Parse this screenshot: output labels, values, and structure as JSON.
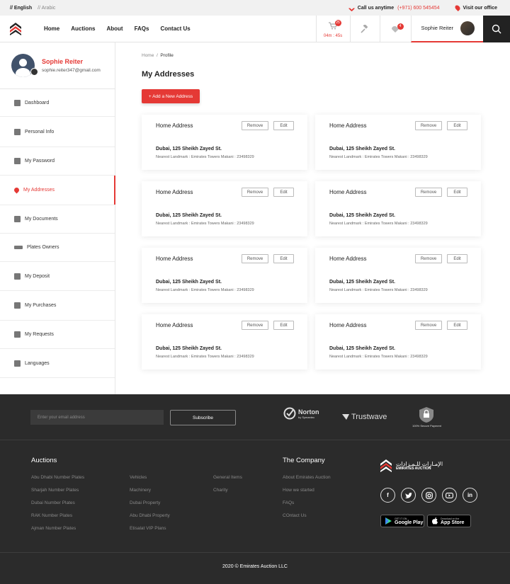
{
  "topbar": {
    "lang_en": "// English",
    "lang_ar": "// Arabic",
    "call_text": "Call us anytime",
    "phone": "(+971) 600 545454",
    "visit": "Visit our office"
  },
  "nav": [
    "Home",
    "Auctions",
    "About",
    "FAQs",
    "Contact Us"
  ],
  "header": {
    "cart_badge": "25",
    "timer": "04m : 45s",
    "notif_badge": "4",
    "user_name": "Sophie Reiter"
  },
  "profile": {
    "name": "Sophie Reiter",
    "email": "sophie.reiter347@gmail.com"
  },
  "menu": [
    {
      "label": "Dashboard",
      "active": false
    },
    {
      "label": "Personal Info",
      "active": false
    },
    {
      "label": "My Password",
      "active": false
    },
    {
      "label": "My Addresses",
      "active": true
    },
    {
      "label": "My Documents",
      "active": false
    },
    {
      "label": "Plates Owners",
      "active": false
    },
    {
      "label": "My Deposit",
      "active": false
    },
    {
      "label": "My Purchases",
      "active": false
    },
    {
      "label": "My Requests",
      "active": false
    },
    {
      "label": "Languages",
      "active": false
    }
  ],
  "breadcrumb": {
    "home": "Home",
    "sep": "/",
    "current": "Profile"
  },
  "page_title": "My Addresses",
  "add_button": "+ Add a New Address",
  "address_buttons": {
    "remove": "Remove",
    "edit": "Edit"
  },
  "addresses": [
    {
      "title": "Home Address",
      "line1": "Dubai, 125 Sheikh Zayed St.",
      "line2": "Nearest Landmark : Emirates Towers Makani : 23498329"
    },
    {
      "title": "Home Address",
      "line1": "Dubai, 125 Sheikh Zayed St.",
      "line2": "Nearest Landmark : Emirates Towers Makani : 23498329"
    },
    {
      "title": "Home Address",
      "line1": "Dubai, 125 Sheikh Zayed St.",
      "line2": "Nearest Landmark : Emirates Towers Makani : 23498329"
    },
    {
      "title": "Home Address",
      "line1": "Dubai, 125 Sheikh Zayed St.",
      "line2": "Nearest Landmark : Emirates Towers Makani : 23498329"
    },
    {
      "title": "Home Address",
      "line1": "Dubai, 125 Sheikh Zayed St.",
      "line2": "Nearest Landmark : Emirates Towers Makani : 23498329"
    },
    {
      "title": "Home Address",
      "line1": "Dubai, 125 Sheikh Zayed St.",
      "line2": "Nearest Landmark : Emirates Towers Makani : 23498329"
    },
    {
      "title": "Home Address",
      "line1": "Dubai, 125 Sheikh Zayed St.",
      "line2": "Nearest Landmark : Emirates Towers Makani : 23498329"
    },
    {
      "title": "Home Address",
      "line1": "Dubai, 125 Sheikh Zayed St.",
      "line2": "Nearest Landmark : Emirates Towers Makani : 23498329"
    }
  ],
  "footer": {
    "email_placeholder": "Enter your email address",
    "subscribe": "Subscribe",
    "norton": "Norton",
    "norton_sub": "by Symantec",
    "trustwave": "Trustwave",
    "secure": "100% Secure Payment",
    "auctions_heading": "Auctions",
    "auctions_col1": [
      "Abu Dhabi Number Plates",
      "Sharjah Number Plates",
      "Dubai Number Plates",
      "RAK Number Plates",
      "Ajman Number Plates"
    ],
    "auctions_col2": [
      "Vehicles",
      "Machinery",
      "Dubai Property",
      "Abu Dhabi Property",
      "Etisalat VIP Plans"
    ],
    "auctions_col3": [
      "General Items",
      "Charity"
    ],
    "company_heading": "The Company",
    "company_links": [
      "About Emirates Auction",
      "How we started",
      "FAQs",
      "COntact Us"
    ],
    "brand_ar": "الإمـارات للـمـزادات",
    "brand_en": "EMIRATES AUCTION",
    "social": [
      "f",
      "t",
      "ig",
      "yt",
      "in"
    ],
    "google_small": "GET IT ON",
    "google_big": "Google Play",
    "apple_small": "Download on the",
    "apple_big": "App Store",
    "copyright": "2020 © Emirates Auction LLC"
  }
}
